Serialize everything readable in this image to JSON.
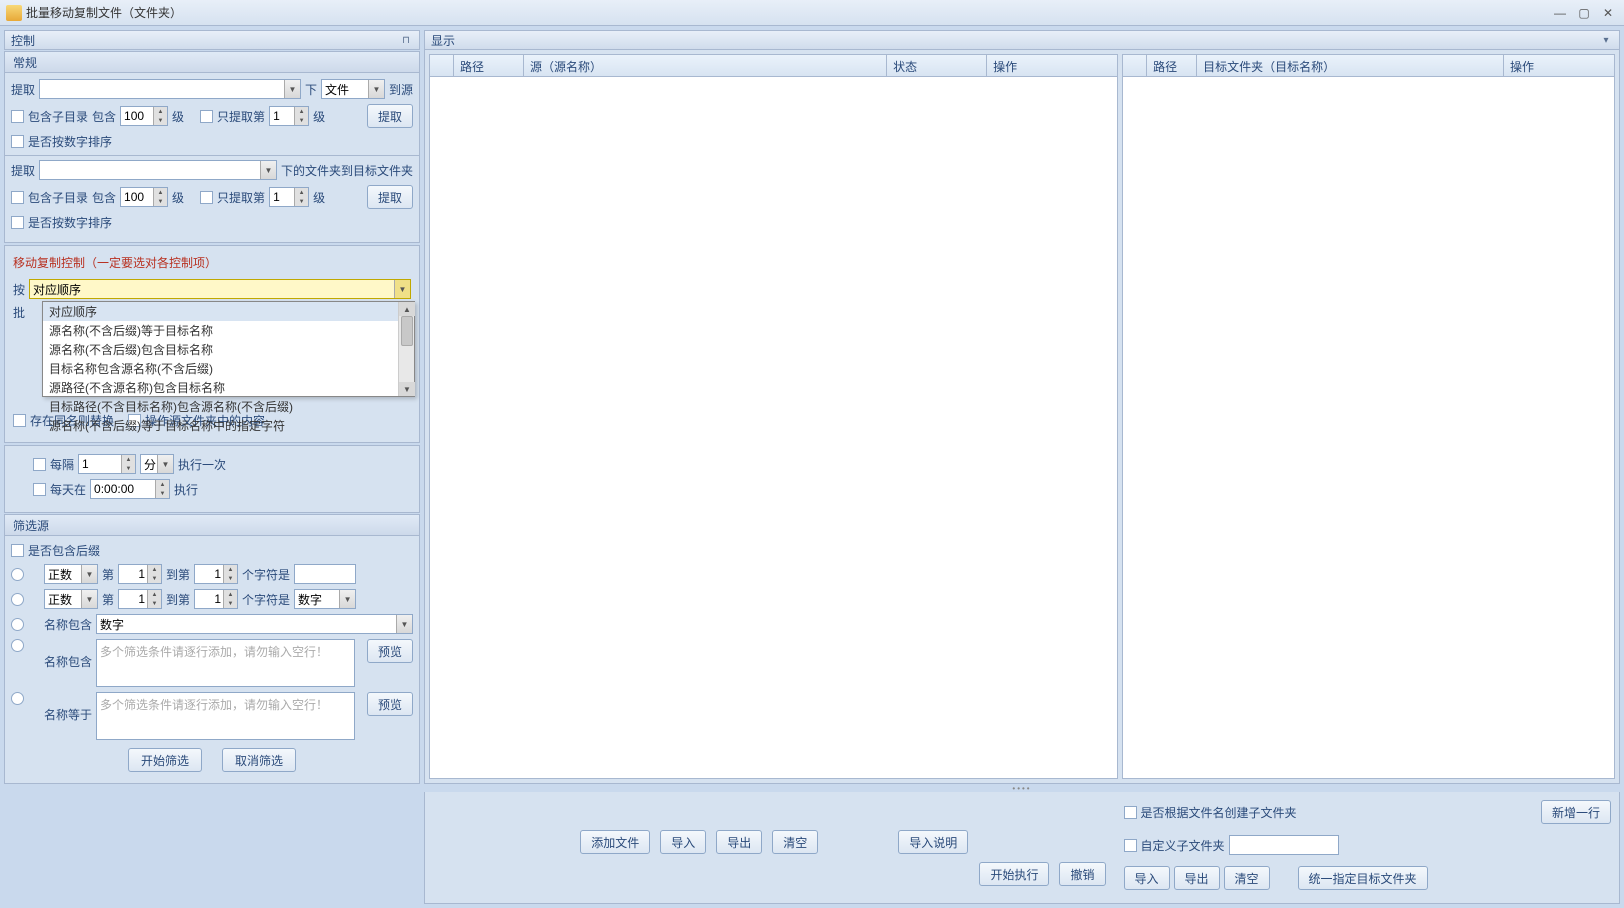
{
  "window": {
    "title": "批量移动复制文件（文件夹）"
  },
  "panels": {
    "left": "控制",
    "right": "显示"
  },
  "groups": {
    "normal": "常规",
    "moveCtrl": "移动复制控制（一定要选对各控制项）",
    "filter": "筛选源"
  },
  "labels": {
    "extract": "提取",
    "under": "下",
    "file": "文件",
    "toSource": "到源",
    "incSubdir": "包含子目录",
    "inc": "包含",
    "level": "级",
    "onlyExtract": "只提取第",
    "extractBtn": "提取",
    "sortByNum": "是否按数字排序",
    "underFilesToTarget": "下的文件夹到目标文件夹",
    "by": "按",
    "batch": "批",
    "replaceSame": "存在同名则替换",
    "operateSrcContent": "操作源文件夹中的内容",
    "every": "每隔",
    "min": "分",
    "execOnce": "执行一次",
    "everyDayAt": "每天在",
    "exec": "执行",
    "incSuffix": "是否包含后缀",
    "positive": "正数",
    "di": "第",
    "toDi": "到第",
    "charIs": "个字符是",
    "number": "数字",
    "nameContains": "名称包含",
    "nameEquals": "名称等于",
    "preview": "预览",
    "multiFilter": "多个筛选条件请逐行添加，请勿输入空行！",
    "startFilter": "开始筛选",
    "cancelFilter": "取消筛选"
  },
  "dropdown": {
    "selected": "对应顺序",
    "items": [
      "对应顺序",
      "源名称(不含后缀)等于目标名称",
      "源名称(不含后缀)包含目标名称",
      "目标名称包含源名称(不含后缀)",
      "源路径(不含源名称)包含目标名称",
      "目标路径(不含目标名称)包含源名称(不含后缀)",
      "源名称(不含后缀)等于目标名称中的指定字符"
    ]
  },
  "values": {
    "hundred": "100",
    "one": "1",
    "time": "0:00:00"
  },
  "table1": {
    "cols": [
      "",
      "路径",
      "源（源名称）",
      "状态",
      "操作"
    ]
  },
  "table2": {
    "cols": [
      "",
      "路径",
      "目标文件夹（目标名称）",
      "操作"
    ]
  },
  "btns": {
    "addFile": "添加文件",
    "import": "导入",
    "export": "导出",
    "clear": "清空",
    "importDesc": "导入说明",
    "startExec": "开始执行",
    "undo": "撤销",
    "newRow": "新增一行",
    "unifyTarget": "统一指定目标文件夹"
  },
  "footer": {
    "createSubByName": "是否根据文件名创建子文件夹",
    "customSub": "自定义子文件夹"
  }
}
